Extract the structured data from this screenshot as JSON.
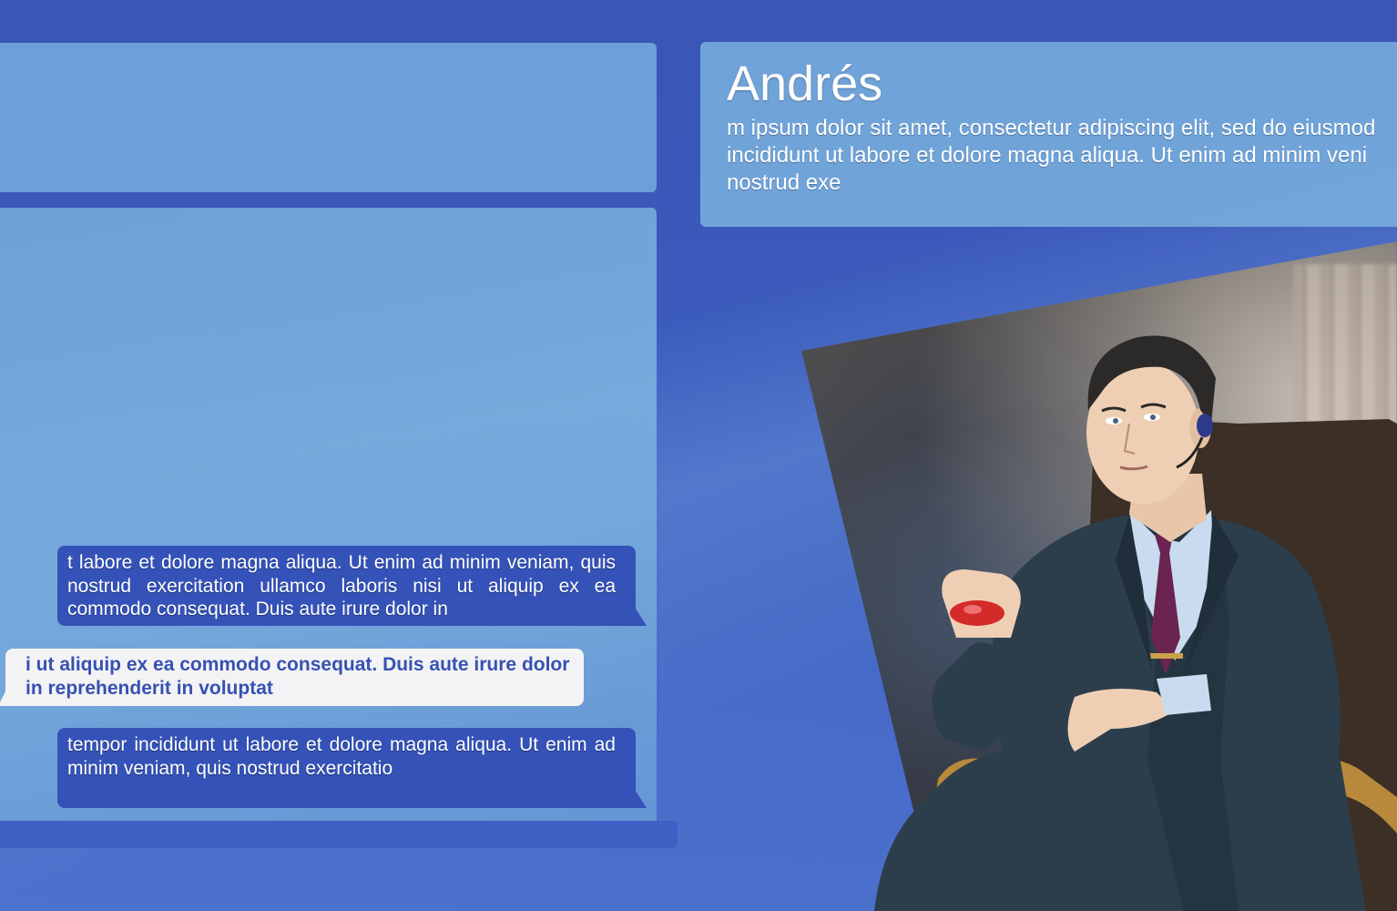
{
  "character": {
    "name": "Andrés",
    "description": "m ipsum dolor sit amet, consectetur adipiscing elit, sed do eiusmod incididunt ut labore et dolore magna aliqua. Ut enim ad minim veni nostrud exe"
  },
  "chat": {
    "messages": [
      {
        "side": "right",
        "text": "t labore et dolore magna aliqua. Ut enim ad minim veniam, quis nostrud exercitation ullamco laboris nisi ut aliquip ex ea commodo consequat. Duis aute irure dolor in"
      },
      {
        "side": "left",
        "text": "i ut aliquip ex ea commodo consequat. Duis aute irure dolor in reprehenderit in voluptat"
      },
      {
        "side": "right",
        "text": "tempor incididunt ut labore et dolore magna aliqua. Ut enim ad minim veniam, quis nostrud exercitatio"
      }
    ]
  },
  "colors": {
    "background": "#3b5bbd",
    "panel": "#7db4e1",
    "bubble_outgoing": "#3452b8",
    "bubble_incoming": "#f3f3f5",
    "incoming_text": "#3651b1"
  },
  "icons": {
    "character_portrait": "businessman-in-armchair-illustration"
  }
}
